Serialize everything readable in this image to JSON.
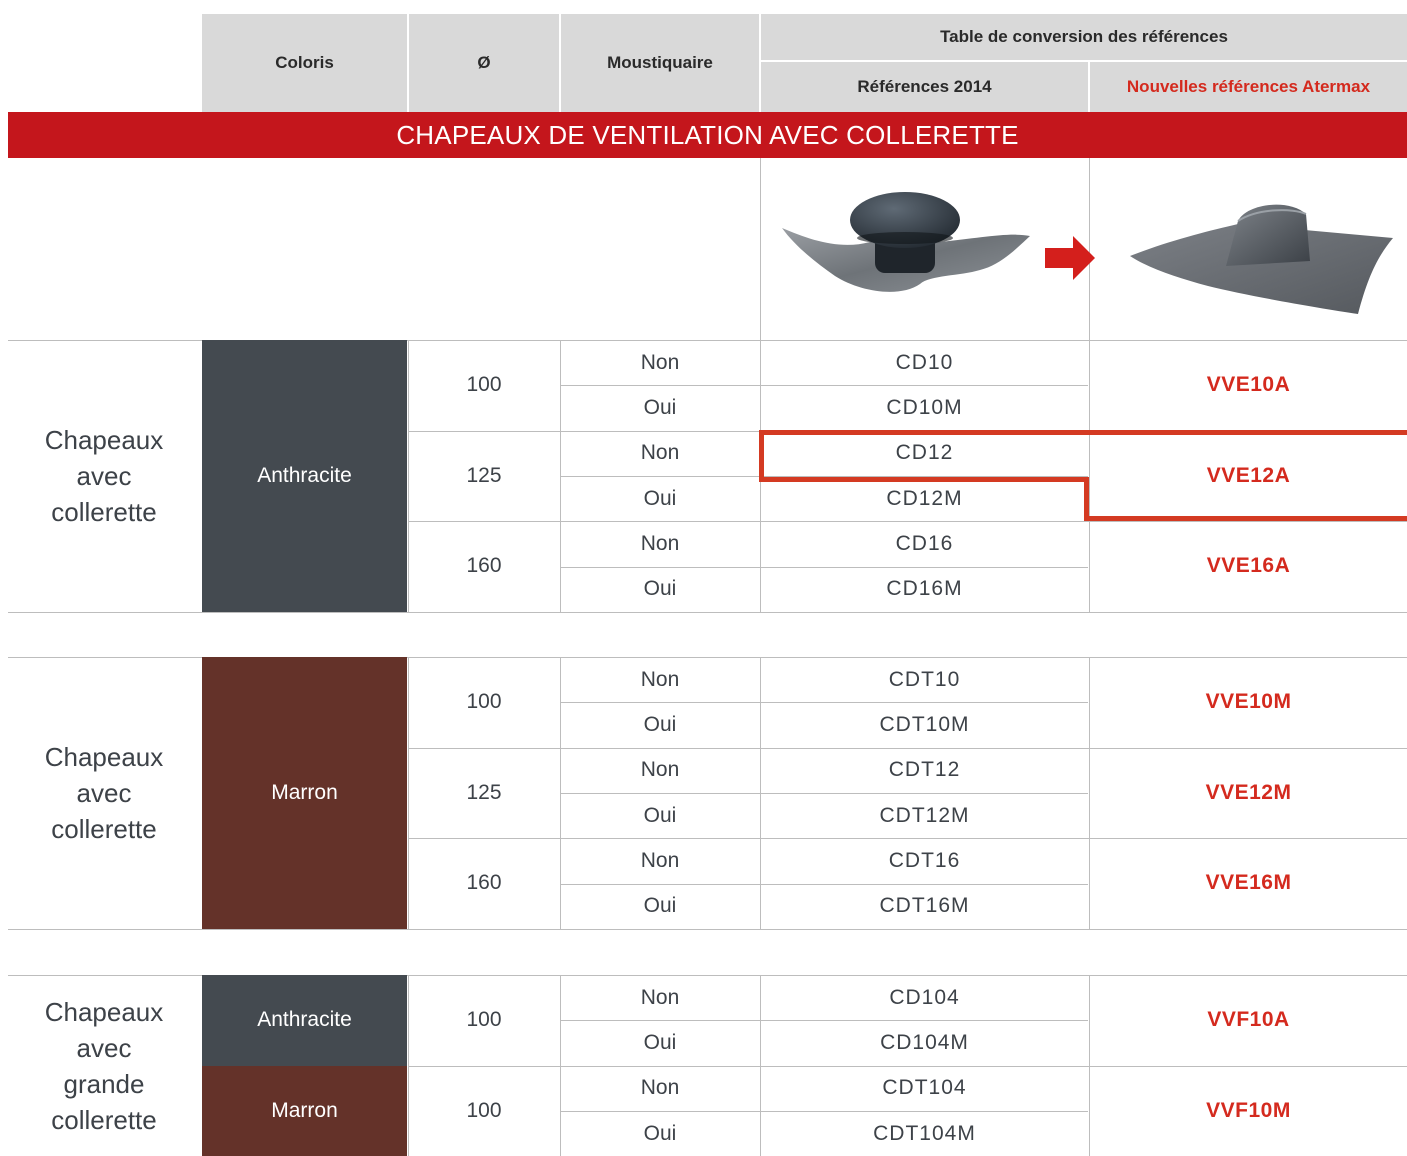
{
  "header": {
    "coloris": "Coloris",
    "diametre": "Ø",
    "moustiquaire": "Moustiquaire",
    "conversion_title": "Table de conversion des références",
    "refs_2014": "Références 2014",
    "new_refs": "Nouvelles références Atermax"
  },
  "banner": "CHAPEAUX DE VENTILATION AVEC COLLERETTE",
  "images": {
    "old_product": "vent-cap-with-flexible-collar",
    "new_product": "vent-cap-with-flat-collar",
    "arrow": "arrow-right-icon"
  },
  "colors": {
    "anthracite": "#444a50",
    "marron": "#643229",
    "accent": "#c4161c",
    "new_ref": "#d42a1e"
  },
  "groups": [
    {
      "category": [
        "Chapeaux",
        "avec",
        "collerette"
      ],
      "color_label": "Anthracite",
      "rows": [
        {
          "diam": "100",
          "sub": [
            {
              "mosq": "Non",
              "ref": "CD10"
            },
            {
              "mosq": "Oui",
              "ref": "CD10M"
            }
          ],
          "new": "VVE10A"
        },
        {
          "diam": "125",
          "sub": [
            {
              "mosq": "Non",
              "ref": "CD12"
            },
            {
              "mosq": "Oui",
              "ref": "CD12M"
            }
          ],
          "new": "VVE12A"
        },
        {
          "diam": "160",
          "sub": [
            {
              "mosq": "Non",
              "ref": "CD16"
            },
            {
              "mosq": "Oui",
              "ref": "CD16M"
            }
          ],
          "new": "VVE16A"
        }
      ]
    },
    {
      "category": [
        "Chapeaux",
        "avec",
        "collerette"
      ],
      "color_label": "Marron",
      "rows": [
        {
          "diam": "100",
          "sub": [
            {
              "mosq": "Non",
              "ref": "CDT10"
            },
            {
              "mosq": "Oui",
              "ref": "CDT10M"
            }
          ],
          "new": "VVE10M"
        },
        {
          "diam": "125",
          "sub": [
            {
              "mosq": "Non",
              "ref": "CDT12"
            },
            {
              "mosq": "Oui",
              "ref": "CDT12M"
            }
          ],
          "new": "VVE12M"
        },
        {
          "diam": "160",
          "sub": [
            {
              "mosq": "Non",
              "ref": "CDT16"
            },
            {
              "mosq": "Oui",
              "ref": "CDT16M"
            }
          ],
          "new": "VVE16M"
        }
      ]
    },
    {
      "category": [
        "Chapeaux",
        "avec",
        "grande",
        "collerette"
      ],
      "rows": [
        {
          "color_label": "Anthracite",
          "diam": "100",
          "sub": [
            {
              "mosq": "Non",
              "ref": "CD104"
            },
            {
              "mosq": "Oui",
              "ref": "CD104M"
            }
          ],
          "new": "VVF10A"
        },
        {
          "color_label": "Marron",
          "diam": "100",
          "sub": [
            {
              "mosq": "Non",
              "ref": "CDT104"
            },
            {
              "mosq": "Oui",
              "ref": "CDT104M"
            }
          ],
          "new": "VVF10M"
        }
      ]
    }
  ]
}
